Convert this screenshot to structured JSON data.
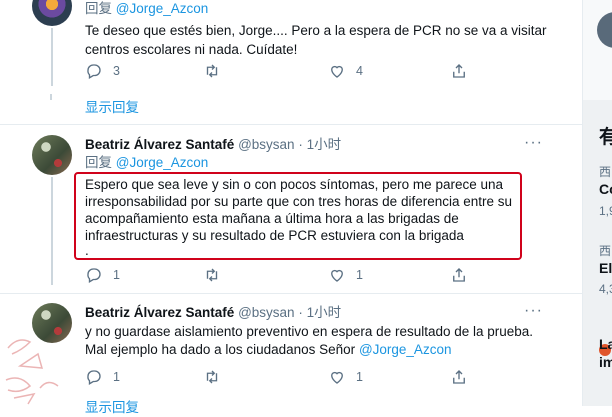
{
  "tweets": [
    {
      "reply_prefix": "回复",
      "reply_handle": "@Jorge_Azcon",
      "lines": [
        "Te deseo que estés bien, Jorge.... Pero a la espera de PCR no se va a visitar",
        "centros escolares ni nada. Cuídate!"
      ],
      "reply_count": "3",
      "like_count": "4",
      "show_replies": "显示回复"
    },
    {
      "name": "Beatriz Álvarez Santafé",
      "handle": "@bsysan",
      "dot": "·",
      "time": "1小时",
      "more": "···",
      "reply_prefix": "回复",
      "reply_handle": "@Jorge_Azcon",
      "lines": [
        "Espero que sea leve y sin o con pocos síntomas, pero me parece una",
        "irresponsabilidad por su parte que con tres horas de diferencia entre su",
        "acompañamiento esta mañana a última hora a las brigadas de",
        "infraestructuras y su resultado de PCR estuviera con la brigada",
        "."
      ],
      "reply_count": "1",
      "like_count": "1"
    },
    {
      "name": "Beatriz Álvarez Santafé",
      "handle": "@bsysan",
      "dot": "·",
      "time": "1小时",
      "more": "···",
      "lines": [
        "y no  guardase aislamiento preventivo en espera de resultado de la prueba.",
        "Mal ejemplo ha dado a los ciudadanos Señor"
      ],
      "mention": "@Jorge_Azcon",
      "reply_count": "1",
      "like_count": "1",
      "show_replies": "显示回复"
    }
  ],
  "sidebar": {
    "heading": "有",
    "items": [
      {
        "meta": "西",
        "title": "Co",
        "sub": "1,9"
      },
      {
        "meta": "西",
        "title": "El",
        "sub": "4,3"
      },
      {
        "meta": "",
        "title": "La",
        "sub": "im"
      }
    ]
  },
  "colors": {
    "accent": "#1b95e0",
    "highlight_box": "#d0021b"
  }
}
